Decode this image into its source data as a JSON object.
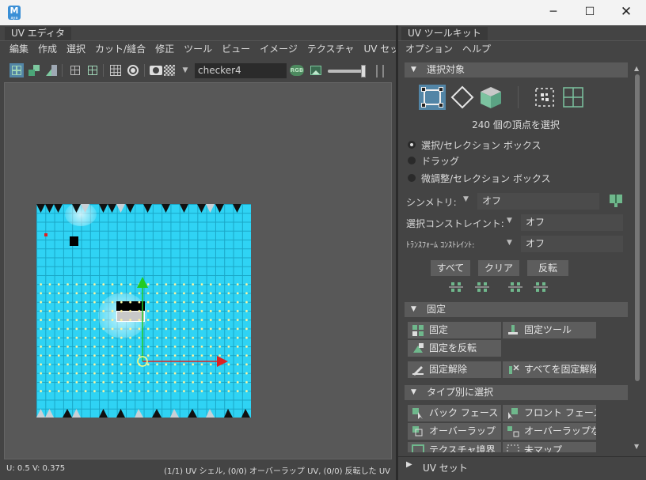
{
  "window": {
    "app_icon": "M",
    "app_icon_sub": "aya",
    "minimize_icon": "─",
    "maximize_icon": "☐",
    "close_icon": "✕"
  },
  "uv_editor": {
    "tab_label": "UV エディタ",
    "menus": [
      "編集",
      "作成",
      "選択",
      "カット/縫合",
      "修正",
      "ツール",
      "ビュー",
      "イメージ",
      "テクスチャ",
      "UV セット"
    ],
    "texture_name": "checker4",
    "rgb_label": "RGB",
    "status_left": "U:  0.5 V:  0.375",
    "status_right": "(1/1) UV シェル, (0/0) オーバーラップ UV, (0/0) 反転した UV"
  },
  "uv_toolkit": {
    "tab_label": "UV ツールキット",
    "menus": [
      "オプション",
      "ヘルプ"
    ],
    "selection": {
      "title": "選択対象",
      "count_text": "240 個の頂点を選択",
      "radios": [
        "選択/セレクション ボックス",
        "ドラッグ",
        "微調整/セレクション ボックス"
      ],
      "selected_radio": 0,
      "symmetry_label": "シンメトリ:",
      "symmetry_value": "オフ",
      "constraint_label": "選択コンストレイント:",
      "constraint_value": "オフ",
      "transform_label": "ﾄﾗﾝｽﾌｫｰﾑ ｺﾝｽﾄﾚｲﾝﾄ:",
      "transform_value": "オフ",
      "btn_all": "すべて",
      "btn_clear": "クリア",
      "btn_invert": "反転"
    },
    "pin": {
      "title": "固定",
      "buttons": [
        "固定",
        "固定ツール",
        "固定を反転",
        "固定解除",
        "すべてを固定解除"
      ]
    },
    "type_select": {
      "title": "タイプ別に選択",
      "buttons": [
        "バック フェース",
        "フロント フェース",
        "オーバーラップ",
        "オーバーラップなし",
        "テクスチャ境界",
        "未マップ"
      ]
    },
    "uvset": {
      "title": "UV セット"
    }
  }
}
